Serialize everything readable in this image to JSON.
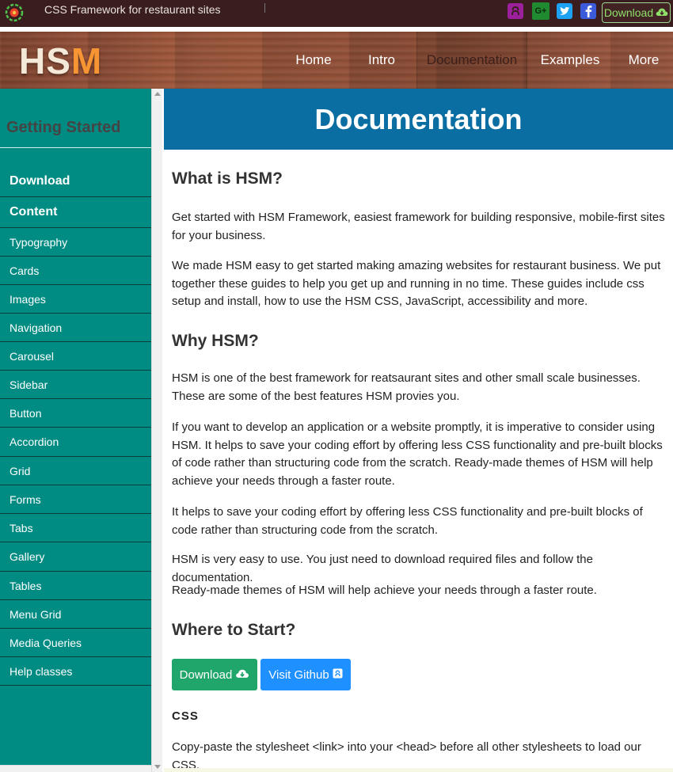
{
  "topbar": {
    "tagline": "CSS Framework for restaurant sites",
    "download_label": "Download",
    "icons": [
      "logo-icon",
      "github-icon",
      "google-plus-icon",
      "twitter-icon",
      "facebook-icon",
      "cloud-download-icon"
    ],
    "gplus_text": "G+"
  },
  "header": {
    "brand_main": "HS",
    "brand_accent": "M",
    "nav": [
      "Home",
      "Intro",
      "Documentation",
      "Examples",
      "More"
    ],
    "active_nav": "Documentation"
  },
  "sidebar": {
    "title": "Getting Started",
    "items": [
      {
        "label": "Download",
        "bold": true
      },
      {
        "label": "Content",
        "bold": true
      },
      {
        "label": "Typography"
      },
      {
        "label": "Cards"
      },
      {
        "label": "Images"
      },
      {
        "label": "Navigation"
      },
      {
        "label": "Carousel"
      },
      {
        "label": "Sidebar"
      },
      {
        "label": "Button"
      },
      {
        "label": "Accordion"
      },
      {
        "label": "Grid"
      },
      {
        "label": "Forms"
      },
      {
        "label": "Tabs"
      },
      {
        "label": "Gallery"
      },
      {
        "label": "Tables"
      },
      {
        "label": "Menu Grid"
      },
      {
        "label": "Media Queries"
      },
      {
        "label": "Help classes"
      }
    ]
  },
  "main": {
    "banner": "Documentation",
    "h_what": "What is HSM?",
    "p1": "Get started with HSM Framework, easiest framework for building responsive, mobile-first sites for your business.",
    "p2": "We made HSM easy to get started making amazing websites for restaurant business. We put together these guides to help you get up and running in no time. These guides include css setup and install, how to use the HSM CSS, JavaScript, accessibility and more.",
    "h_why": "Why HSM?",
    "p3": "HSM is one of the best framework for reatsaurant sites and other small scale businesses. These are some of the best features HSM provies you.",
    "p4": "If you want to develop an application or a website promptly, it is imperative to consider using HSM. It helps to save your coding effort by offering less CSS functionality and pre-built blocks of code rather than structuring code from the scratch. Ready-made themes of HSM will help achieve your needs through a faster route.",
    "p5": "It helps to save your coding effort by offering less CSS functionality and pre-built blocks of code rather than structuring code from the scratch.",
    "p6": "HSM is very easy to use. You just need to download required files and follow the documentation.",
    "p7": "Ready-made themes of HSM will help achieve your needs through a faster route.",
    "h_start": "Where to Start?",
    "btn_download": "Download",
    "btn_github": "Visit Github",
    "css_heading": "CSS",
    "p8": "Copy-paste the stylesheet <link> into your <head> before all other stylesheets to load our CSS."
  },
  "colors": {
    "topbar": "#3a1e1f",
    "sidebar": "#008b83",
    "banner": "#0a6ea3",
    "download_btn": "#20a56a",
    "github_btn": "#1e90ff",
    "brand_accent": "#f79433"
  }
}
